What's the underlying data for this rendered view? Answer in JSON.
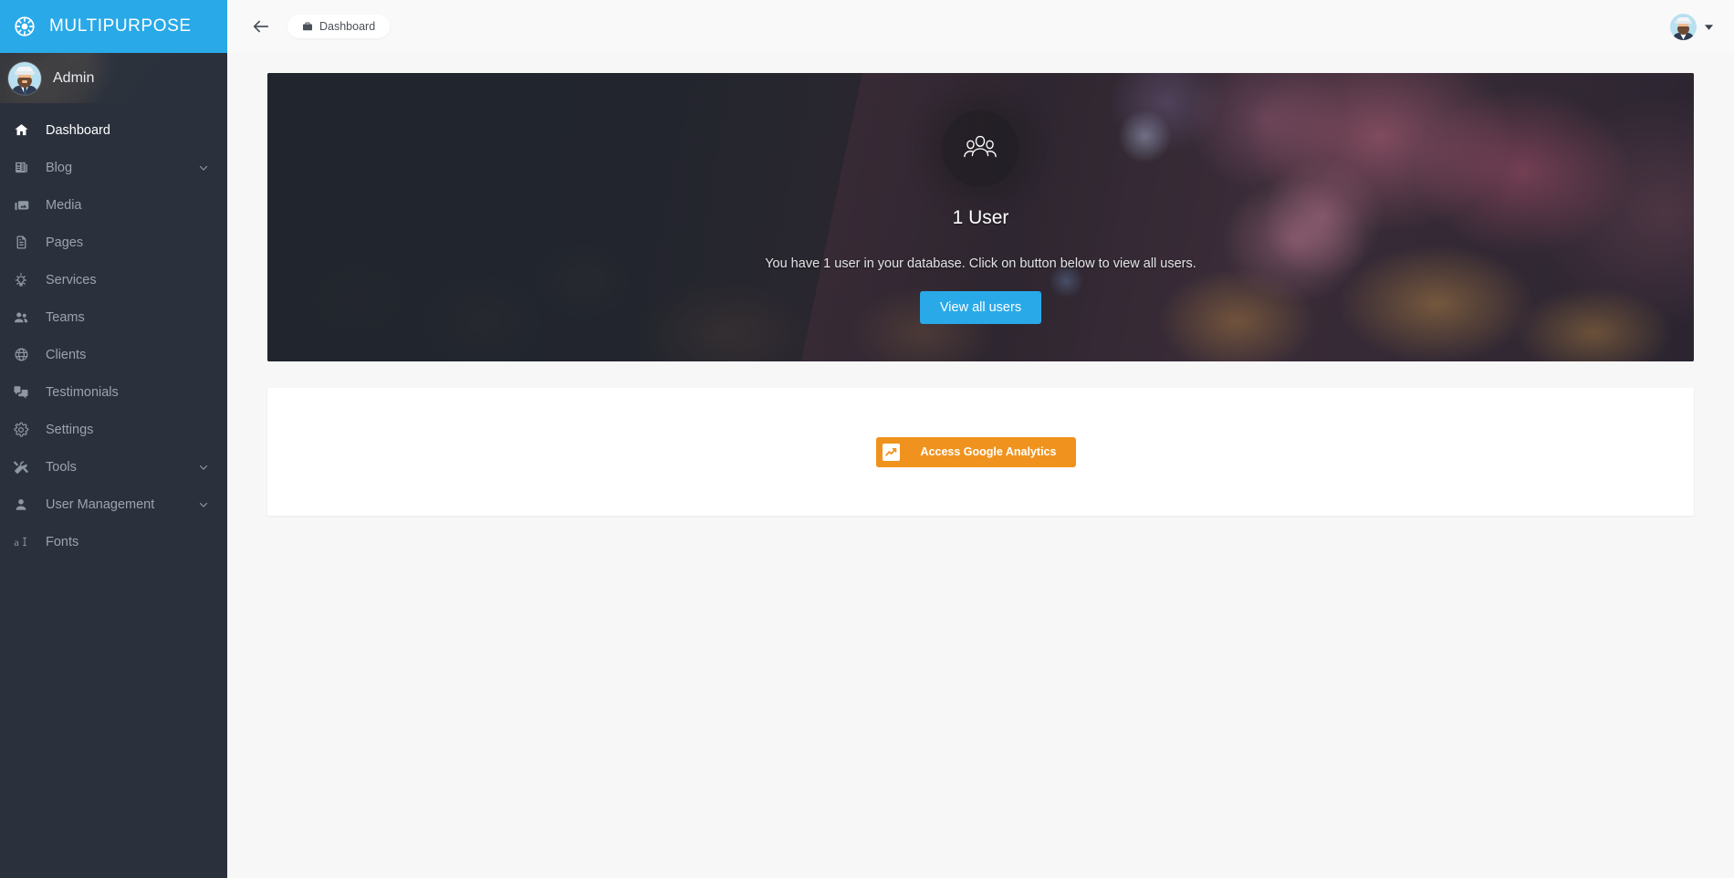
{
  "brand": {
    "name": "MULTIPURPOSE",
    "icon": "ship-wheel-icon",
    "color": "#29a9e8"
  },
  "sidebar": {
    "profile": {
      "name": "Admin",
      "avatar": "user-avatar"
    },
    "items": [
      {
        "label": "Dashboard",
        "icon": "home-icon",
        "active": true,
        "expandable": false
      },
      {
        "label": "Blog",
        "icon": "newspaper-icon",
        "active": false,
        "expandable": true
      },
      {
        "label": "Media",
        "icon": "image-icon",
        "active": false,
        "expandable": false
      },
      {
        "label": "Pages",
        "icon": "file-icon",
        "active": false,
        "expandable": false
      },
      {
        "label": "Services",
        "icon": "lightbulb-icon",
        "active": false,
        "expandable": false
      },
      {
        "label": "Teams",
        "icon": "users-icon",
        "active": false,
        "expandable": false
      },
      {
        "label": "Clients",
        "icon": "globe-icon",
        "active": false,
        "expandable": false
      },
      {
        "label": "Testimonials",
        "icon": "comments-icon",
        "active": false,
        "expandable": false
      },
      {
        "label": "Settings",
        "icon": "gear-icon",
        "active": false,
        "expandable": false
      },
      {
        "label": "Tools",
        "icon": "tools-icon",
        "active": false,
        "expandable": true
      },
      {
        "label": "User Management",
        "icon": "user-icon",
        "active": false,
        "expandable": true
      },
      {
        "label": "Fonts",
        "icon": "font-icon",
        "active": false,
        "expandable": false
      }
    ]
  },
  "topbar": {
    "back_icon": "arrow-left-icon",
    "breadcrumb": {
      "label": "Dashboard",
      "icon": "briefcase-icon"
    },
    "avatar": "user-avatar",
    "caret": "caret-down-icon"
  },
  "hero": {
    "badge_icon": "group-users-icon",
    "title": "1 User",
    "subtitle": "You have 1 user in your database. Click on button below to view all users.",
    "button_label": "View all users",
    "button_color": "#29a9e8"
  },
  "analytics_card": {
    "button_label": "Access Google Analytics",
    "button_color": "#f0931e",
    "icon": "google-analytics-icon"
  }
}
